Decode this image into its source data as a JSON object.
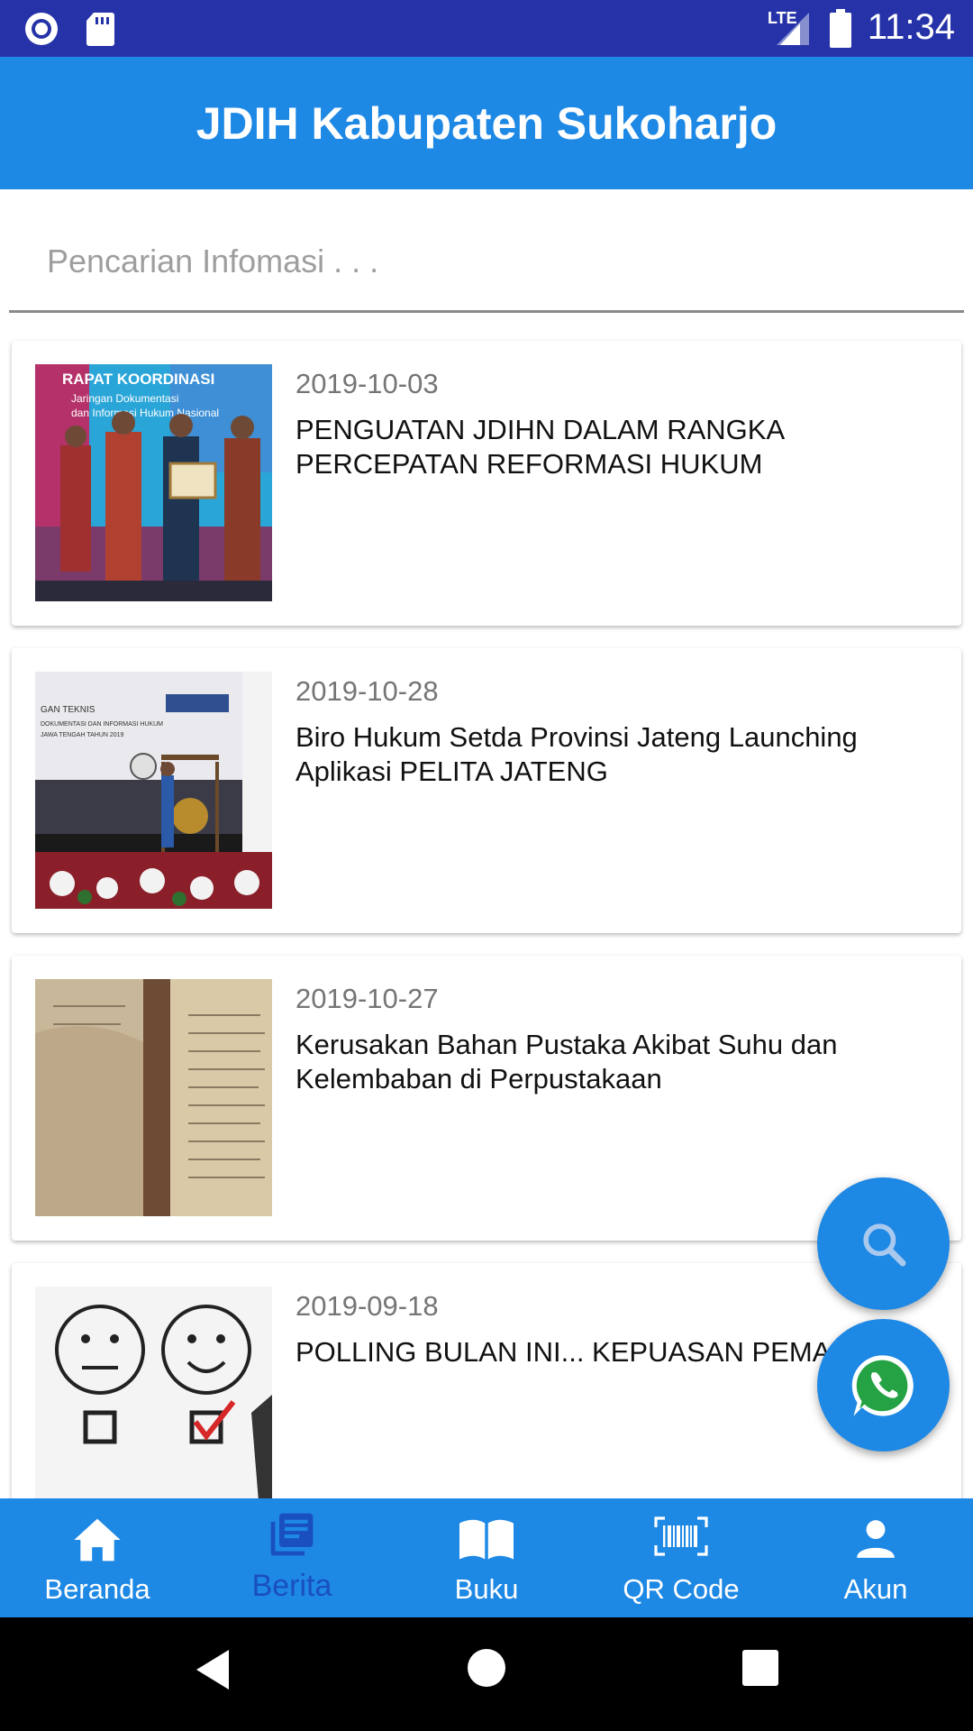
{
  "status_bar": {
    "time": "11:34",
    "network": "LTE",
    "icons": [
      "notification-circle-icon",
      "sd-card-icon",
      "lte-signal-icon",
      "battery-icon"
    ]
  },
  "app_bar": {
    "title": "JDIH Kabupaten Sukoharjo"
  },
  "search": {
    "placeholder": "Pencarian Infomasi . . .",
    "value": ""
  },
  "news": [
    {
      "date": "2019-10-03",
      "title": "PENGUATAN JDIHN DALAM RANGKA PERCEPATAN REFORMASI HUKUM"
    },
    {
      "date": "2019-10-28",
      "title": "Biro Hukum Setda Provinsi Jateng Launching Aplikasi PELITA JATENG"
    },
    {
      "date": "2019-10-27",
      "title": "Kerusakan Bahan Pustaka Akibat Suhu dan Kelembaban di Perpustakaan"
    },
    {
      "date": "2019-09-18",
      "title": "POLLING BULAN INI... KEPUASAN PEMAK"
    }
  ],
  "fabs": {
    "search_icon": "search-icon",
    "whatsapp_icon": "whatsapp-icon"
  },
  "bottom_nav": {
    "active": "Berita",
    "items": [
      {
        "label": "Beranda",
        "icon": "home-icon"
      },
      {
        "label": "Berita",
        "icon": "news-icon"
      },
      {
        "label": "Buku",
        "icon": "book-icon"
      },
      {
        "label": "QR Code",
        "icon": "barcode-icon"
      },
      {
        "label": "Akun",
        "icon": "person-icon"
      }
    ]
  },
  "colors": {
    "status_bar": "#2633a8",
    "primary": "#1e88e5",
    "active_nav": "#1a4fc0",
    "date_text": "#757575"
  }
}
